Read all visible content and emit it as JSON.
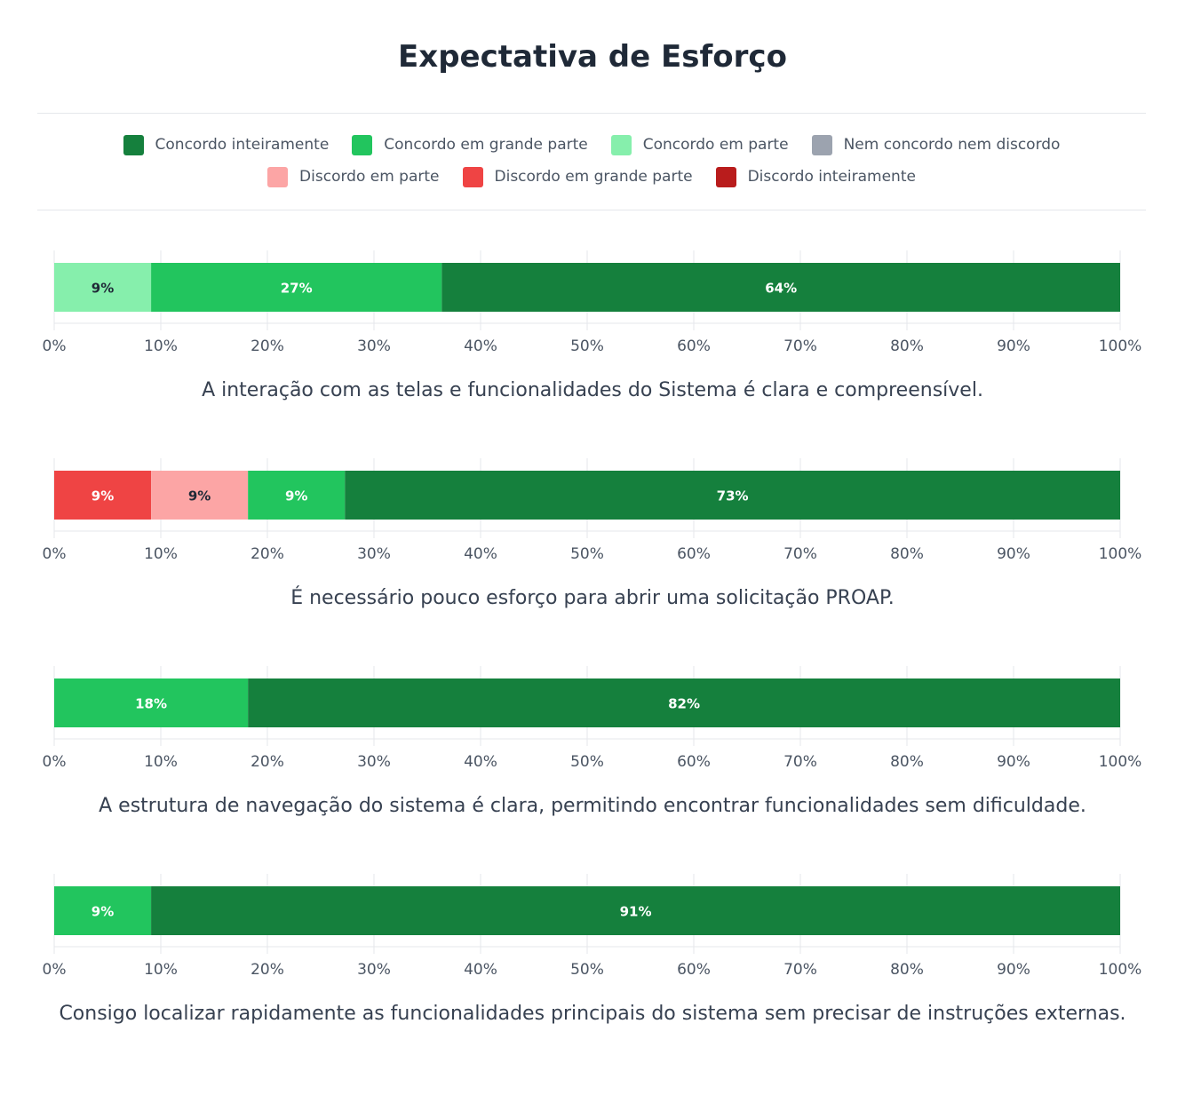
{
  "title": "Expectativa de Esforço",
  "legend": [
    {
      "label": "Concordo inteiramente",
      "color": "#15803d"
    },
    {
      "label": "Concordo em grande parte",
      "color": "#22c55e"
    },
    {
      "label": "Concordo em parte",
      "color": "#86efac"
    },
    {
      "label": "Nem concordo nem discordo",
      "color": "#9ca3af"
    },
    {
      "label": "Discordo em parte",
      "color": "#fca5a5"
    },
    {
      "label": "Discordo em grande parte",
      "color": "#ef4444"
    },
    {
      "label": "Discordo inteiramente",
      "color": "#b91c1c"
    }
  ],
  "chart_data": [
    {
      "type": "bar",
      "orientation": "horizontal",
      "stacked": true,
      "xlim": [
        0,
        100
      ],
      "xticks": [
        "0%",
        "10%",
        "20%",
        "30%",
        "40%",
        "50%",
        "60%",
        "70%",
        "80%",
        "90%",
        "100%"
      ],
      "caption": "A interação com as telas e funcionalidades do Sistema é clara e compreensível.",
      "segments": [
        {
          "name": "Concordo em parte",
          "value": 9.09,
          "label": "9%",
          "color": "#86efac",
          "text_color": "#1f2937"
        },
        {
          "name": "Concordo em grande parte",
          "value": 27.27,
          "label": "27%",
          "color": "#22c55e",
          "text_color": "#ffffff"
        },
        {
          "name": "Concordo inteiramente",
          "value": 63.64,
          "label": "64%",
          "color": "#15803d",
          "text_color": "#ffffff"
        }
      ]
    },
    {
      "type": "bar",
      "orientation": "horizontal",
      "stacked": true,
      "xlim": [
        0,
        100
      ],
      "xticks": [
        "0%",
        "10%",
        "20%",
        "30%",
        "40%",
        "50%",
        "60%",
        "70%",
        "80%",
        "90%",
        "100%"
      ],
      "caption": "É necessário pouco esforço para abrir uma solicitação PROAP.",
      "segments": [
        {
          "name": "Discordo em grande parte",
          "value": 9.09,
          "label": "9%",
          "color": "#ef4444",
          "text_color": "#ffffff"
        },
        {
          "name": "Discordo em parte",
          "value": 9.09,
          "label": "9%",
          "color": "#fca5a5",
          "text_color": "#1f2937"
        },
        {
          "name": "Concordo em grande parte",
          "value": 9.09,
          "label": "9%",
          "color": "#22c55e",
          "text_color": "#ffffff"
        },
        {
          "name": "Concordo inteiramente",
          "value": 72.73,
          "label": "73%",
          "color": "#15803d",
          "text_color": "#ffffff"
        }
      ]
    },
    {
      "type": "bar",
      "orientation": "horizontal",
      "stacked": true,
      "xlim": [
        0,
        100
      ],
      "xticks": [
        "0%",
        "10%",
        "20%",
        "30%",
        "40%",
        "50%",
        "60%",
        "70%",
        "80%",
        "90%",
        "100%"
      ],
      "caption": "A estrutura de navegação do sistema é clara, permitindo encontrar funcionalidades sem dificuldade.",
      "segments": [
        {
          "name": "Concordo em grande parte",
          "value": 18.18,
          "label": "18%",
          "color": "#22c55e",
          "text_color": "#ffffff"
        },
        {
          "name": "Concordo inteiramente",
          "value": 81.82,
          "label": "82%",
          "color": "#15803d",
          "text_color": "#ffffff"
        }
      ]
    },
    {
      "type": "bar",
      "orientation": "horizontal",
      "stacked": true,
      "xlim": [
        0,
        100
      ],
      "xticks": [
        "0%",
        "10%",
        "20%",
        "30%",
        "40%",
        "50%",
        "60%",
        "70%",
        "80%",
        "90%",
        "100%"
      ],
      "caption": "Consigo localizar rapidamente as funcionalidades principais do sistema sem precisar de instruções externas.",
      "segments": [
        {
          "name": "Concordo em grande parte",
          "value": 9.09,
          "label": "9%",
          "color": "#22c55e",
          "text_color": "#ffffff"
        },
        {
          "name": "Concordo inteiramente",
          "value": 90.91,
          "label": "91%",
          "color": "#15803d",
          "text_color": "#ffffff"
        }
      ]
    }
  ]
}
